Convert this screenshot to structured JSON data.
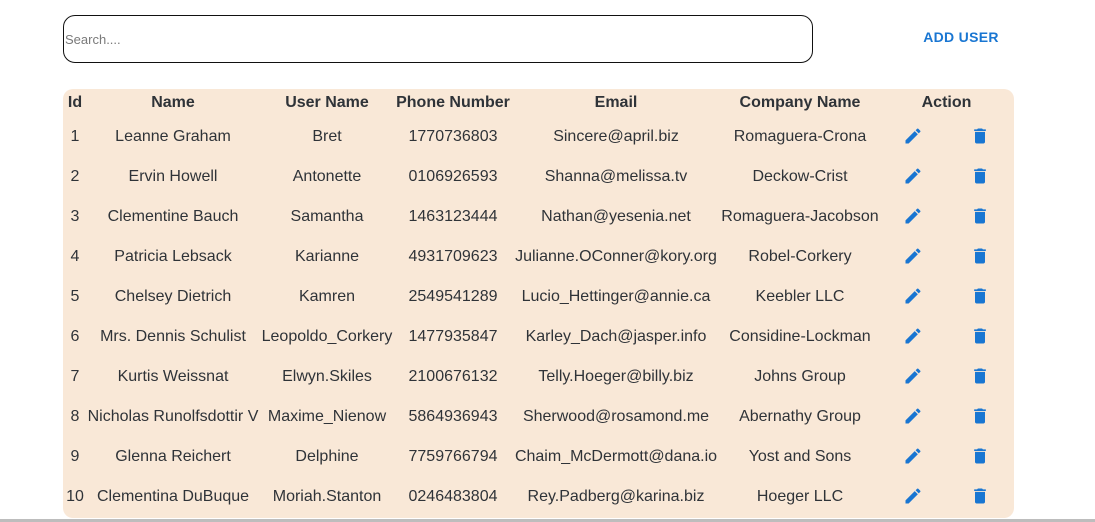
{
  "search": {
    "placeholder": "Search....",
    "value": ""
  },
  "toolbar": {
    "add_user_label": "ADD USER"
  },
  "colors": {
    "accent": "#1976d2",
    "table_background": "#f9e8d7",
    "text": "#2f3338"
  },
  "table": {
    "headers": {
      "id": "Id",
      "name": "Name",
      "username": "User Name",
      "phone": "Phone Number",
      "email": "Email",
      "company": "Company Name",
      "action": "Action"
    },
    "action_icons": [
      "pencil-edit-icon",
      "trash-delete-icon"
    ],
    "rows": [
      {
        "id": "1",
        "name": "Leanne Graham",
        "username": "Bret",
        "phone": "1770736803",
        "email": "Sincere@april.biz",
        "company": "Romaguera-Crona"
      },
      {
        "id": "2",
        "name": "Ervin Howell",
        "username": "Antonette",
        "phone": "0106926593",
        "email": "Shanna@melissa.tv",
        "company": "Deckow-Crist"
      },
      {
        "id": "3",
        "name": "Clementine Bauch",
        "username": "Samantha",
        "phone": "1463123444",
        "email": "Nathan@yesenia.net",
        "company": "Romaguera-Jacobson"
      },
      {
        "id": "4",
        "name": "Patricia Lebsack",
        "username": "Karianne",
        "phone": "4931709623",
        "email": "Julianne.OConner@kory.org",
        "company": "Robel-Corkery"
      },
      {
        "id": "5",
        "name": "Chelsey Dietrich",
        "username": "Kamren",
        "phone": "2549541289",
        "email": "Lucio_Hettinger@annie.ca",
        "company": "Keebler LLC"
      },
      {
        "id": "6",
        "name": "Mrs. Dennis Schulist",
        "username": "Leopoldo_Corkery",
        "phone": "1477935847",
        "email": "Karley_Dach@jasper.info",
        "company": "Considine-Lockman"
      },
      {
        "id": "7",
        "name": "Kurtis Weissnat",
        "username": "Elwyn.Skiles",
        "phone": "2100676132",
        "email": "Telly.Hoeger@billy.biz",
        "company": "Johns Group"
      },
      {
        "id": "8",
        "name": "Nicholas Runolfsdottir V",
        "username": "Maxime_Nienow",
        "phone": "5864936943",
        "email": "Sherwood@rosamond.me",
        "company": "Abernathy Group"
      },
      {
        "id": "9",
        "name": "Glenna Reichert",
        "username": "Delphine",
        "phone": "7759766794",
        "email": "Chaim_McDermott@dana.io",
        "company": "Yost and Sons"
      },
      {
        "id": "10",
        "name": "Clementina DuBuque",
        "username": "Moriah.Stanton",
        "phone": "0246483804",
        "email": "Rey.Padberg@karina.biz",
        "company": "Hoeger LLC"
      }
    ]
  }
}
